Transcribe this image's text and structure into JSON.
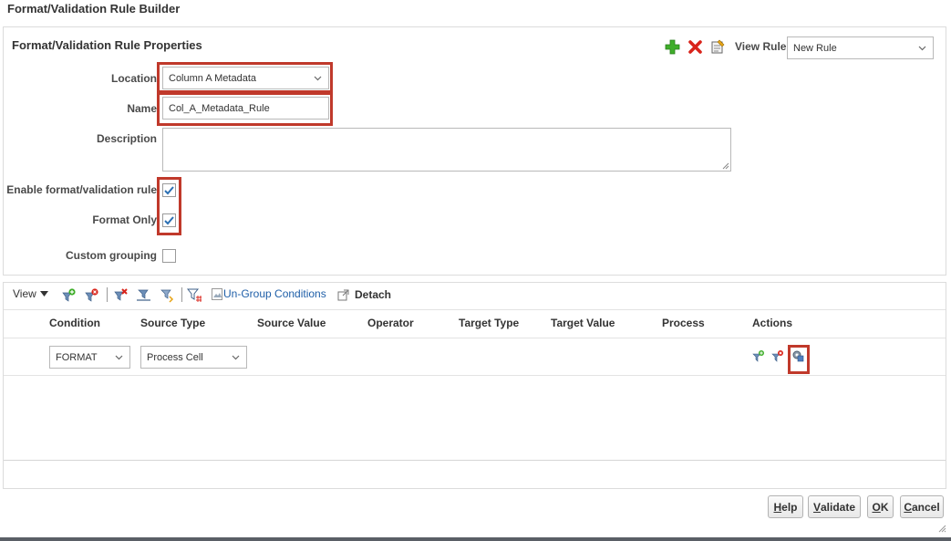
{
  "window_title": "Format/Validation Rule Builder",
  "properties": {
    "section_title": "Format/Validation Rule Properties",
    "view_rule_label": "View Rule",
    "view_rule_value": "New Rule",
    "location_label": "Location",
    "location_value": "Column A Metadata",
    "name_label": "Name",
    "name_value": "Col_A_Metadata_Rule",
    "description_label": "Description",
    "description_value": "",
    "enable_label": "Enable format/validation rule",
    "enable_checked": true,
    "format_only_label": "Format Only",
    "format_only_checked": true,
    "custom_grouping_label": "Custom grouping",
    "custom_grouping_checked": false
  },
  "toolbar": {
    "view_label": "View",
    "ungroup_label": "Un-Group Conditions",
    "detach_label": "Detach"
  },
  "grid": {
    "columns": [
      "Condition",
      "Source Type",
      "Source Value",
      "Operator",
      "Target Type",
      "Target Value",
      "Process",
      "Actions"
    ],
    "rows": [
      {
        "condition": "FORMAT",
        "source_type": "Process Cell"
      }
    ]
  },
  "buttons": {
    "help_mnemonic": "H",
    "help_rest": "elp",
    "validate_mnemonic": "V",
    "validate_rest": "alidate",
    "ok_mnemonic": "O",
    "ok_rest": "K",
    "cancel_mnemonic": "C",
    "cancel_rest": "ancel"
  },
  "colors": {
    "highlight": "#c0392b",
    "add_green": "#3fae2a",
    "delete_red": "#d9241b",
    "link_blue": "#1f5fa8"
  },
  "icons": [
    "add-icon",
    "delete-icon",
    "edit-icon",
    "add-condition-icon",
    "delete-condition-icon",
    "group-icon",
    "ungroup-icon",
    "filter-icon",
    "detach-icon",
    "checkmark-icon",
    "chevron-down-icon"
  ]
}
